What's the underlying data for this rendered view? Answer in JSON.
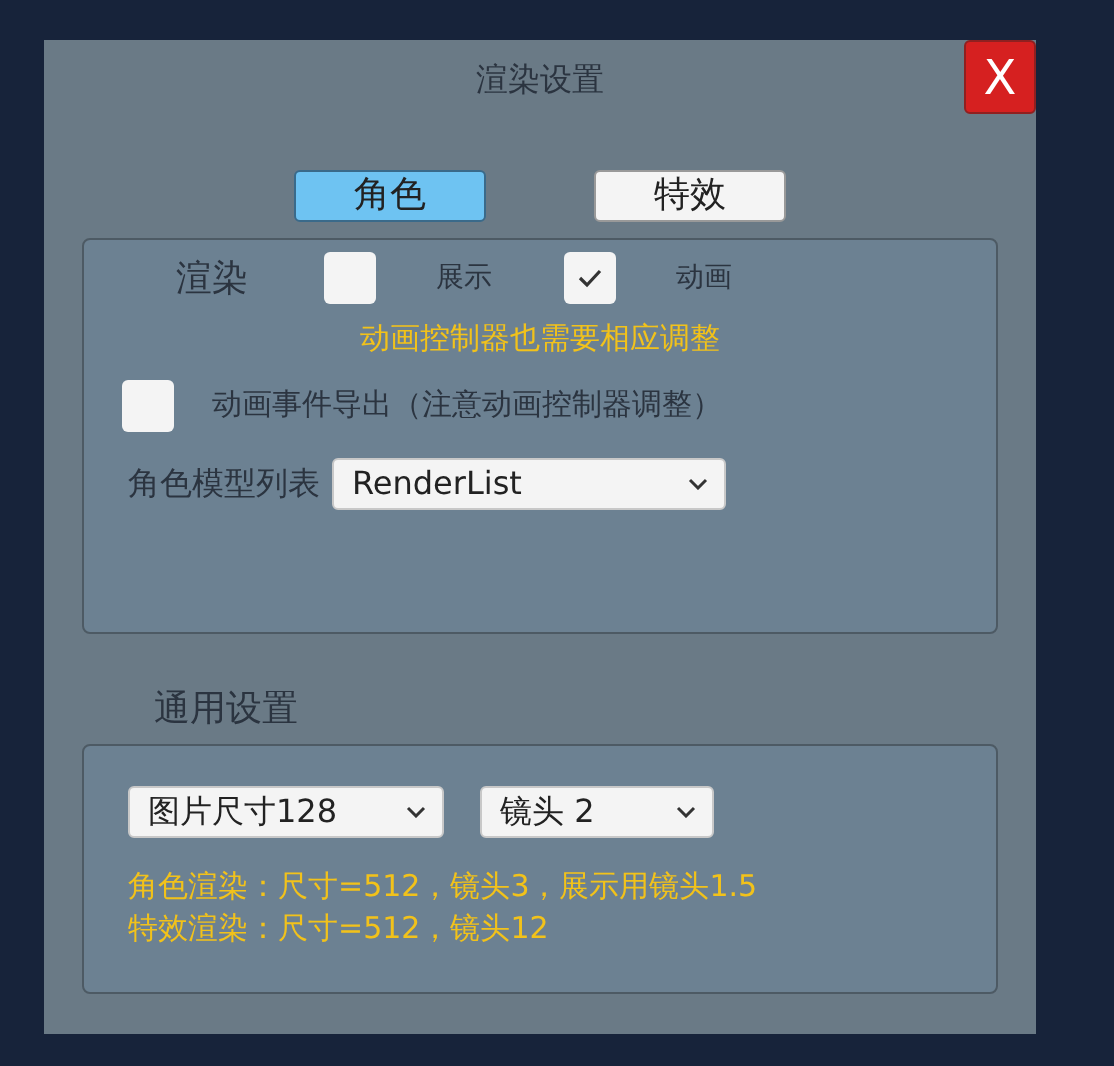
{
  "window": {
    "title": "渲染设置",
    "close": "X"
  },
  "tabs": [
    {
      "label": "角色",
      "selected": true
    },
    {
      "label": "特效",
      "selected": false
    }
  ],
  "render": {
    "label": "渲染",
    "options": [
      {
        "label": "展示",
        "checked": false
      },
      {
        "label": "动画",
        "checked": true
      }
    ],
    "warning": "动画控制器也需要相应调整"
  },
  "export_events": {
    "label": "动画事件导出（注意动画控制器调整）",
    "checked": false
  },
  "model_list": {
    "label": "角色模型列表",
    "value": "RenderList"
  },
  "general": {
    "title": "通用设置",
    "selects": [
      {
        "value": "图片尺寸128"
      },
      {
        "value": "镜头 2"
      }
    ],
    "notes": [
      "角色渲染：尺寸=512，镜头3，展示用镜头1.5",
      "特效渲染：尺寸=512，镜头12"
    ]
  }
}
